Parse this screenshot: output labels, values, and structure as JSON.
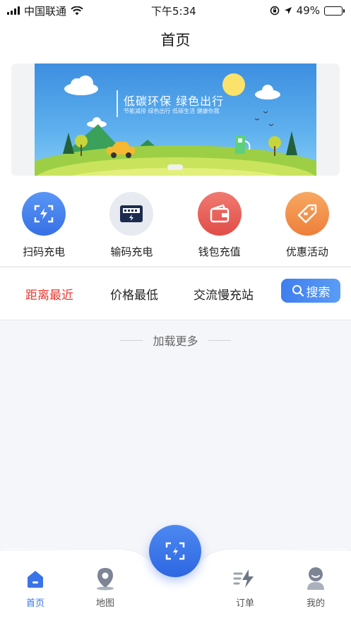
{
  "status_bar": {
    "carrier": "中国联通",
    "time": "下午5:34",
    "battery_percent": "49%",
    "battery_level": 0.49
  },
  "header": {
    "title": "首页"
  },
  "banner": {
    "title": "低碳环保  绿色出行",
    "subtitle": "节能减排 绿色出行 低碳生活 健康你我"
  },
  "actions": [
    {
      "label": "扫码充电",
      "icon": "scan-charge-icon",
      "color": "#3f7ef0"
    },
    {
      "label": "输码充电",
      "icon": "code-charge-icon",
      "color": "#e7eaf0"
    },
    {
      "label": "钱包充值",
      "icon": "wallet-icon",
      "color": "#ec5e58"
    },
    {
      "label": "优惠活动",
      "icon": "coupon-icon",
      "color": "#f2914a"
    }
  ],
  "filters": {
    "items": [
      "距离最近",
      "价格最低",
      "交流慢充站"
    ],
    "active": "距离最近",
    "search_label": "搜索"
  },
  "load_more": "加载更多",
  "tabbar": {
    "items": [
      {
        "label": "首页",
        "icon": "home-icon",
        "active": true
      },
      {
        "label": "地图",
        "icon": "map-pin-icon",
        "active": false
      },
      {
        "label": "订单",
        "icon": "order-bolt-icon",
        "active": false
      },
      {
        "label": "我的",
        "icon": "profile-icon",
        "active": false
      }
    ],
    "center_button_icon": "scan-icon"
  },
  "colors": {
    "accent": "#3b74e8",
    "active_filter": "#e8382f"
  }
}
